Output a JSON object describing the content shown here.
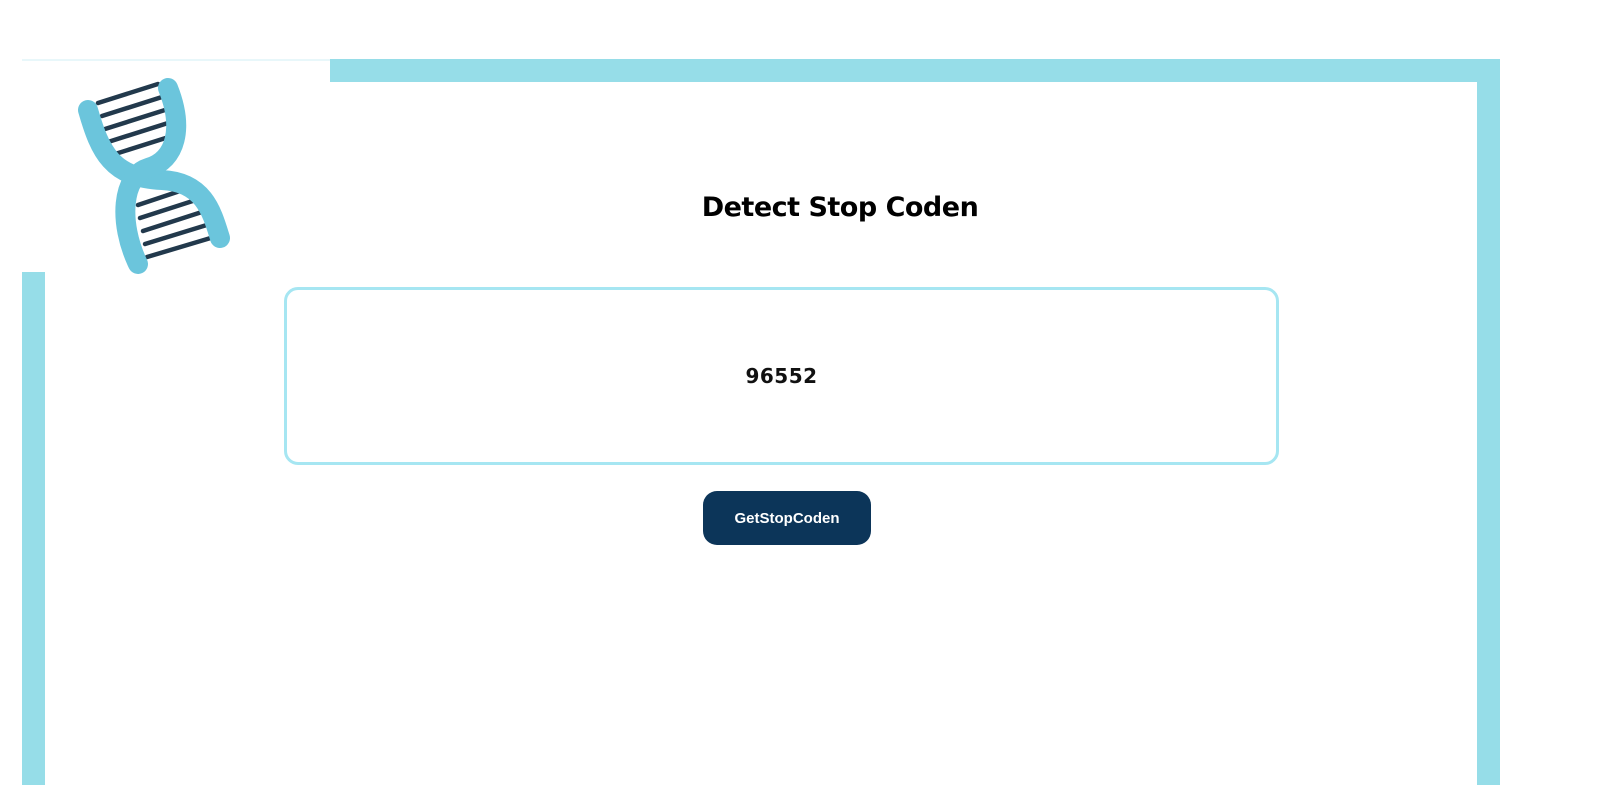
{
  "logo": {
    "icon": "dna-icon",
    "strand_color": "#6bc5dc",
    "rung_color": "#22394c"
  },
  "header": {
    "title": "Detect Stop Coden"
  },
  "result": {
    "value": "96552"
  },
  "actions": {
    "get_button_label": "GetStopCoden"
  },
  "colors": {
    "frame": "#96dde8",
    "box_border": "#a6e6f2",
    "button_bg": "#0c3559",
    "button_text": "#ffffff"
  }
}
